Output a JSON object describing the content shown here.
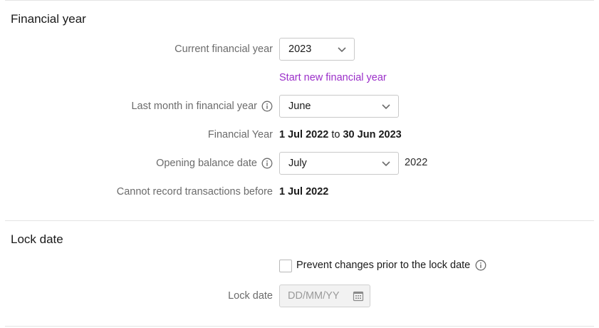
{
  "financial_year": {
    "heading": "Financial year",
    "current_year_label": "Current financial year",
    "current_year_value": "2023",
    "start_new_link": "Start new financial year",
    "last_month_label": "Last month in financial year",
    "last_month_value": "June",
    "fy_label": "Financial Year",
    "fy_start": "1 Jul 2022",
    "fy_to": "to",
    "fy_end": "30 Jun 2023",
    "opening_label": "Opening balance date",
    "opening_month": "July",
    "opening_year": "2022",
    "cannot_record_label": "Cannot record transactions before",
    "cannot_record_value": "1 Jul 2022"
  },
  "lock_date": {
    "heading": "Lock date",
    "prevent_label": "Prevent changes prior to the lock date",
    "prevent_checked": false,
    "lock_date_label": "Lock date",
    "lock_date_placeholder": "DD/MM/YY"
  },
  "icons": {
    "info": "info-icon",
    "chevron": "chevron-down-icon",
    "calendar": "calendar-icon"
  },
  "colors": {
    "link": "#9b2fc9",
    "label": "#6b6b6b",
    "text": "#1a1a1a"
  }
}
